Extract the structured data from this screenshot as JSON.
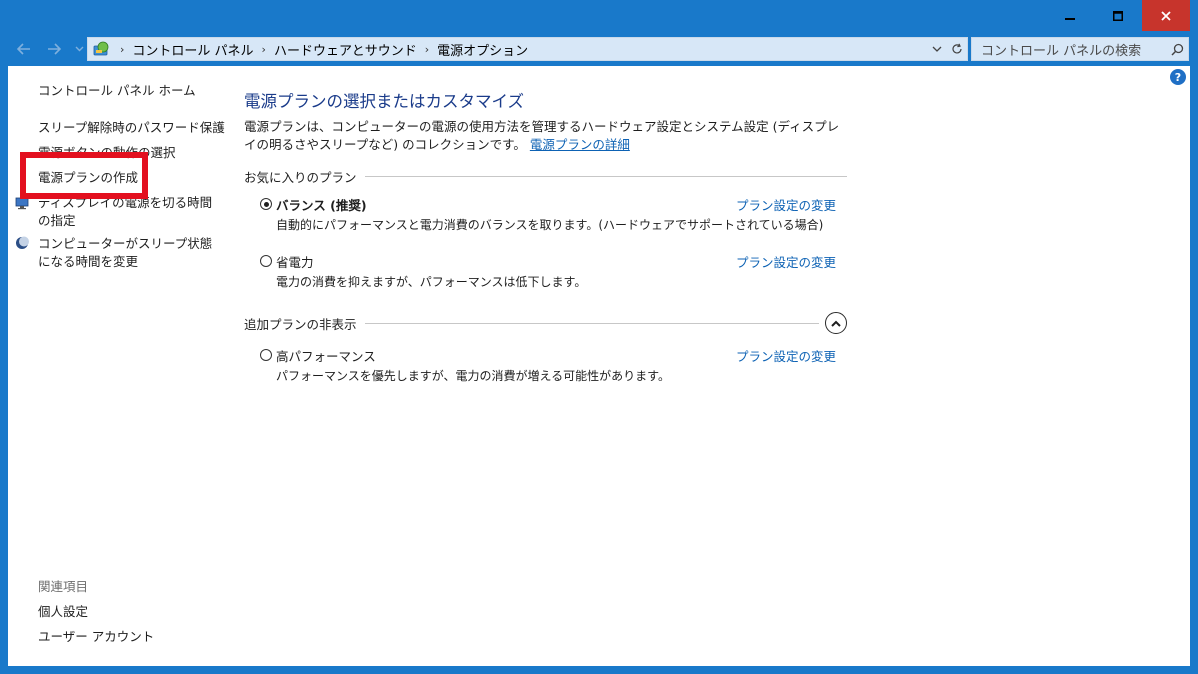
{
  "window": {
    "minimize_glyph": "minimize-icon",
    "maximize_glyph": "maximize-icon",
    "close_glyph": "close-icon"
  },
  "address": {
    "breadcrumbs": [
      "コントロール パネル",
      "ハードウェアとサウンド",
      "電源オプション"
    ],
    "search_placeholder": "コントロール パネルの検索"
  },
  "left_pane": {
    "home": "コントロール パネル ホーム",
    "items": [
      "スリープ解除時のパスワード保護",
      "電源ボタンの動作の選択",
      "電源プランの作成",
      "ディスプレイの電源を切る時間の指定",
      "コンピューターがスリープ状態になる時間を変更"
    ],
    "related_heading": "関連項目",
    "related_items": [
      "個人設定",
      "ユーザー アカウント"
    ]
  },
  "main": {
    "title": "電源プランの選択またはカスタマイズ",
    "description": "電源プランは、コンピューターの電源の使用方法を管理するハードウェア設定とシステム設定 (ディスプレイの明るさやスリープなど) のコレクションです。",
    "description_link": "電源プランの詳細",
    "favorites_heading": "お気に入りのプラン",
    "hidden_heading": "追加プランの非表示",
    "change_link": "プラン設定の変更",
    "plans": [
      {
        "name": "バランス (推奨)",
        "desc": "自動的にパフォーマンスと電力消費のバランスを取ります。(ハードウェアでサポートされている場合)",
        "selected": true
      },
      {
        "name": "省電力",
        "desc": "電力の消費を抑えますが、パフォーマンスは低下します。",
        "selected": false
      },
      {
        "name": "高パフォーマンス",
        "desc": "パフォーマンスを優先しますが、電力の消費が増える可能性があります。",
        "selected": false
      }
    ]
  },
  "colors": {
    "titlebar": "#1979ca",
    "close": "#c7342c",
    "link": "#0d62b4",
    "title_text": "#1a3b8a",
    "highlight": "#e3101f"
  }
}
